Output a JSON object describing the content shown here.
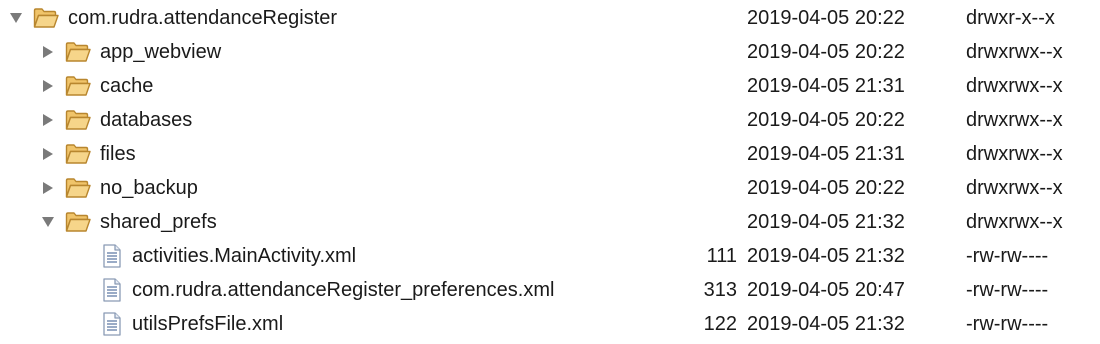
{
  "colors": {
    "folder_fill": "#f6d58a",
    "folder_stroke": "#b8862e",
    "file_stroke": "#8a9bb5",
    "file_lines": "#6f87ad",
    "toggle": "#7a7a7a"
  },
  "rows": [
    {
      "name": "com.rudra.attendanceRegister",
      "size": "",
      "date": "2019-04-05",
      "time": "20:22",
      "perms": "drwxr-x--x",
      "type": "folder",
      "expanded": true,
      "icon": "folder-open-icon"
    },
    {
      "name": "app_webview",
      "size": "",
      "date": "2019-04-05",
      "time": "20:22",
      "perms": "drwxrwx--x",
      "type": "folder",
      "expanded": false,
      "icon": "folder-open-icon"
    },
    {
      "name": "cache",
      "size": "",
      "date": "2019-04-05",
      "time": "21:31",
      "perms": "drwxrwx--x",
      "type": "folder",
      "expanded": false,
      "icon": "folder-open-icon"
    },
    {
      "name": "databases",
      "size": "",
      "date": "2019-04-05",
      "time": "20:22",
      "perms": "drwxrwx--x",
      "type": "folder",
      "expanded": false,
      "icon": "folder-open-icon"
    },
    {
      "name": "files",
      "size": "",
      "date": "2019-04-05",
      "time": "21:31",
      "perms": "drwxrwx--x",
      "type": "folder",
      "expanded": false,
      "icon": "folder-open-icon"
    },
    {
      "name": "no_backup",
      "size": "",
      "date": "2019-04-05",
      "time": "20:22",
      "perms": "drwxrwx--x",
      "type": "folder",
      "expanded": false,
      "icon": "folder-open-icon"
    },
    {
      "name": "shared_prefs",
      "size": "",
      "date": "2019-04-05",
      "time": "21:32",
      "perms": "drwxrwx--x",
      "type": "folder",
      "expanded": true,
      "icon": "folder-open-icon"
    },
    {
      "name": "activities.MainActivity.xml",
      "size": "111",
      "date": "2019-04-05",
      "time": "21:32",
      "perms": "-rw-rw----",
      "type": "file",
      "icon": "xml-file-icon"
    },
    {
      "name": "com.rudra.attendanceRegister_preferences.xml",
      "size": "313",
      "date": "2019-04-05",
      "time": "20:47",
      "perms": "-rw-rw----",
      "type": "file",
      "icon": "xml-file-icon"
    },
    {
      "name": "utilsPrefsFile.xml",
      "size": "122",
      "date": "2019-04-05",
      "time": "21:32",
      "perms": "-rw-rw----",
      "type": "file",
      "icon": "xml-file-icon"
    }
  ]
}
